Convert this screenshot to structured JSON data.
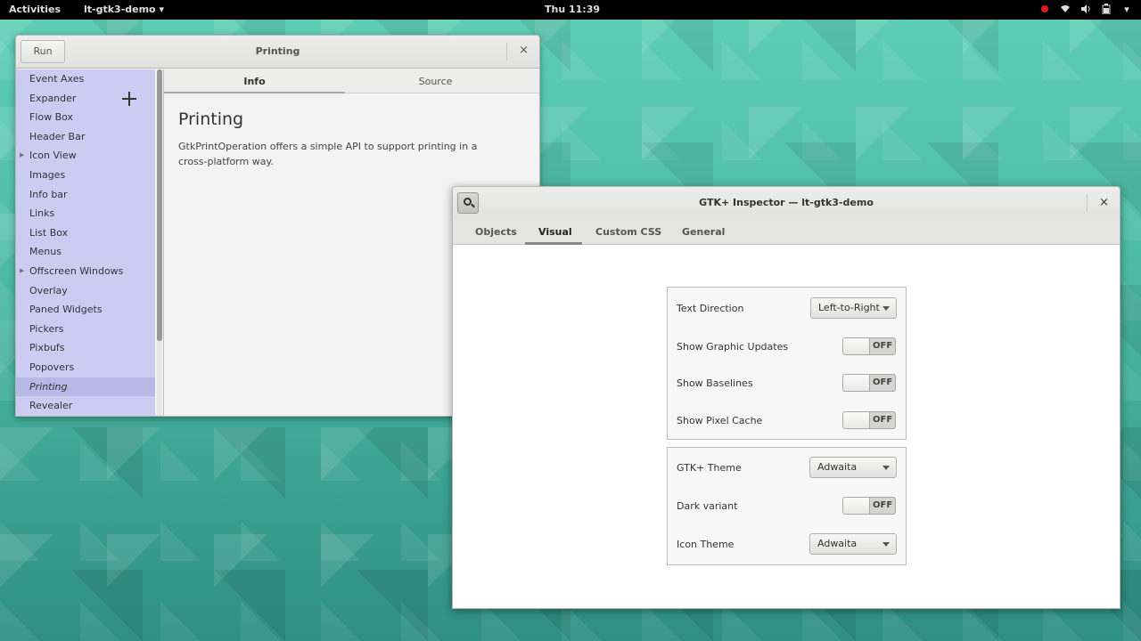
{
  "topbar": {
    "activities": "Activities",
    "app_menu": "lt-gtk3-demo ▾",
    "clock": "Thu 11:39",
    "tray_icons": [
      "record-indicator-icon",
      "wifi-icon",
      "volume-icon",
      "battery-icon",
      "power-icon"
    ]
  },
  "demo_window": {
    "run_label": "Run",
    "title": "Printing",
    "close": "×",
    "sidebar_items": [
      {
        "label": "Event Axes",
        "expandable": false
      },
      {
        "label": "Expander",
        "expandable": false
      },
      {
        "label": "Flow Box",
        "expandable": false
      },
      {
        "label": "Header Bar",
        "expandable": false
      },
      {
        "label": "Icon View",
        "expandable": true
      },
      {
        "label": "Images",
        "expandable": false
      },
      {
        "label": "Info bar",
        "expandable": false
      },
      {
        "label": "Links",
        "expandable": false
      },
      {
        "label": "List Box",
        "expandable": false
      },
      {
        "label": "Menus",
        "expandable": false
      },
      {
        "label": "Offscreen Windows",
        "expandable": true
      },
      {
        "label": "Overlay",
        "expandable": false
      },
      {
        "label": "Paned Widgets",
        "expandable": false
      },
      {
        "label": "Pickers",
        "expandable": false
      },
      {
        "label": "Pixbufs",
        "expandable": false
      },
      {
        "label": "Popovers",
        "expandable": false
      },
      {
        "label": "Printing",
        "expandable": false,
        "selected": true
      },
      {
        "label": "Revealer",
        "expandable": false
      }
    ],
    "tabs": {
      "info": "Info",
      "source": "Source"
    },
    "content_title": "Printing",
    "content_text": "GtkPrintOperation offers a simple API to support printing in a cross-platform way."
  },
  "inspector": {
    "title": "GTK+ Inspector — lt-gtk3-demo",
    "close": "×",
    "tabs": [
      "Objects",
      "Visual",
      "Custom CSS",
      "General"
    ],
    "active_tab": "Visual",
    "text_direction": {
      "label": "Text Direction",
      "value": "Left-to-Right"
    },
    "graphic_updates": {
      "label": "Show Graphic Updates",
      "state": "OFF"
    },
    "baselines": {
      "label": "Show Baselines",
      "state": "OFF"
    },
    "pixel_cache": {
      "label": "Show Pixel Cache",
      "state": "OFF"
    },
    "gtk_theme": {
      "label": "GTK+ Theme",
      "value": "Adwaita"
    },
    "dark_variant": {
      "label": "Dark variant",
      "state": "OFF"
    },
    "icon_theme": {
      "label": "Icon Theme",
      "value": "Adwaita"
    }
  }
}
